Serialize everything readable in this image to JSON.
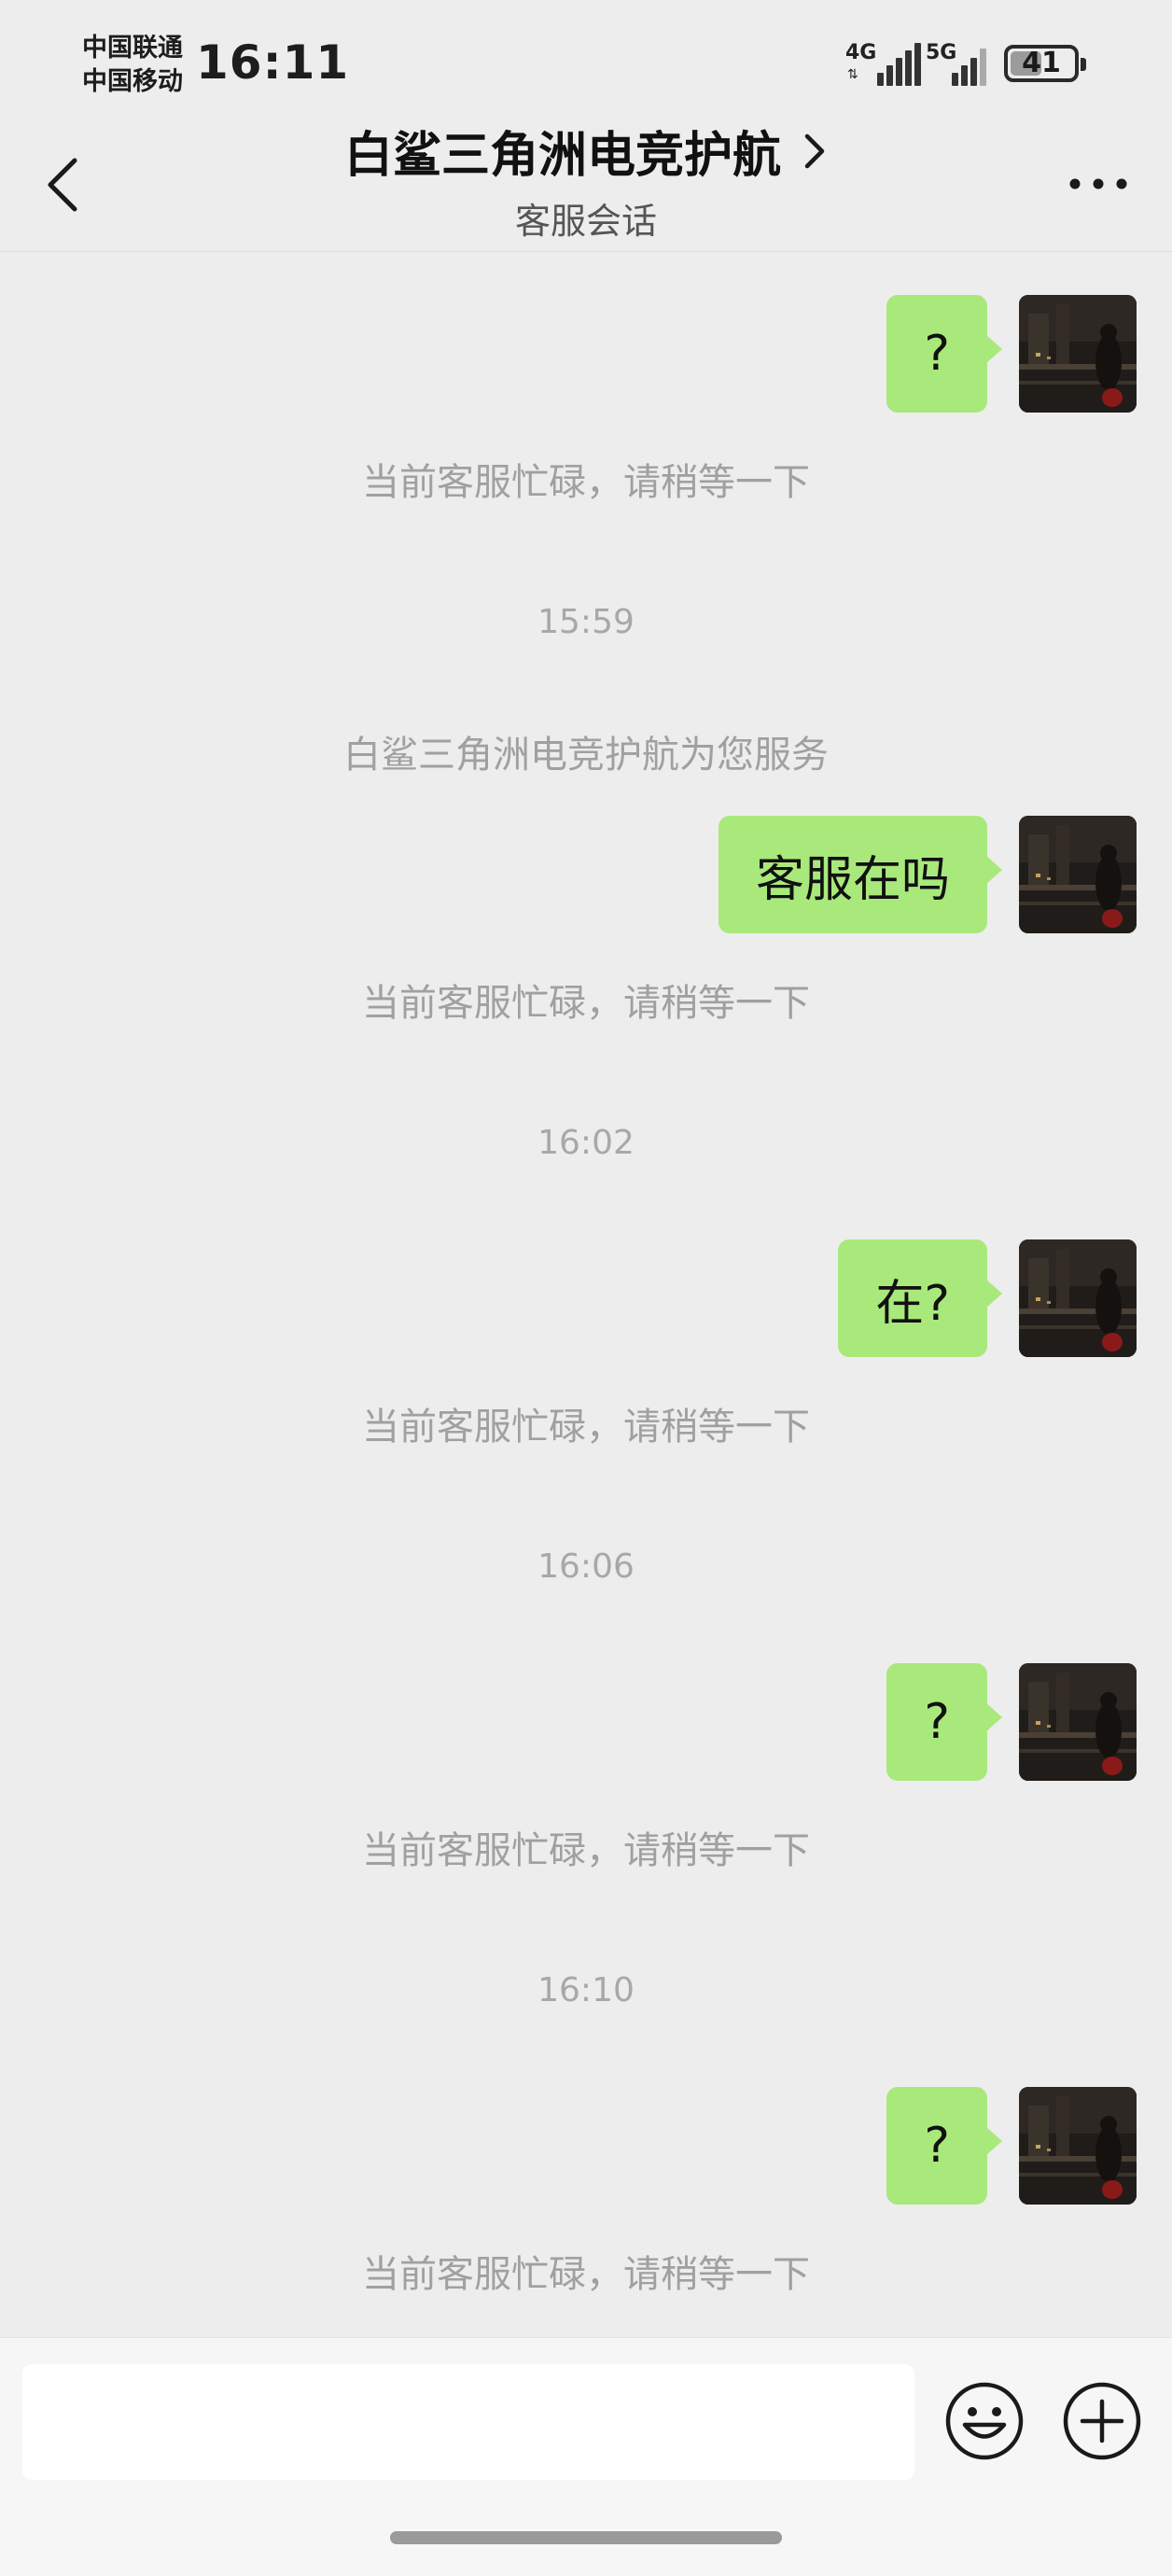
{
  "status_bar": {
    "carrier_1": "中国联通",
    "carrier_2": "中国移动",
    "time": "16:11",
    "signal_1": "4G",
    "signal_2": "5G",
    "battery": "41"
  },
  "header": {
    "title": "白鲨三角洲电竞护航",
    "subtitle": "客服会话"
  },
  "messages": [
    {
      "kind": "outgoing",
      "text": "?"
    },
    {
      "kind": "system",
      "text": "当前客服忙碌，请稍等一下"
    },
    {
      "kind": "timestamp",
      "text": "15:59"
    },
    {
      "kind": "system",
      "text": "白鲨三角洲电竞护航为您服务"
    },
    {
      "kind": "outgoing",
      "text": "客服在吗"
    },
    {
      "kind": "system",
      "text": "当前客服忙碌，请稍等一下"
    },
    {
      "kind": "timestamp",
      "text": "16:02"
    },
    {
      "kind": "outgoing",
      "text": "在?"
    },
    {
      "kind": "system",
      "text": "当前客服忙碌，请稍等一下"
    },
    {
      "kind": "timestamp",
      "text": "16:06"
    },
    {
      "kind": "outgoing",
      "text": "?"
    },
    {
      "kind": "system",
      "text": "当前客服忙碌，请稍等一下"
    },
    {
      "kind": "timestamp",
      "text": "16:10"
    },
    {
      "kind": "outgoing",
      "text": "?"
    },
    {
      "kind": "system",
      "text": "当前客服忙碌，请稍等一下"
    }
  ],
  "input": {
    "value": "",
    "placeholder": ""
  },
  "icons": {
    "back": "chevron-left-icon",
    "title_arrow": "chevron-right-icon",
    "more": "more-horizontal-icon",
    "emoji": "smiley-face-icon",
    "plus": "plus-circle-icon"
  },
  "colors": {
    "background": "#ededed",
    "outgoing_bubble": "#a9e97c",
    "system_text": "#a0a0a0"
  }
}
